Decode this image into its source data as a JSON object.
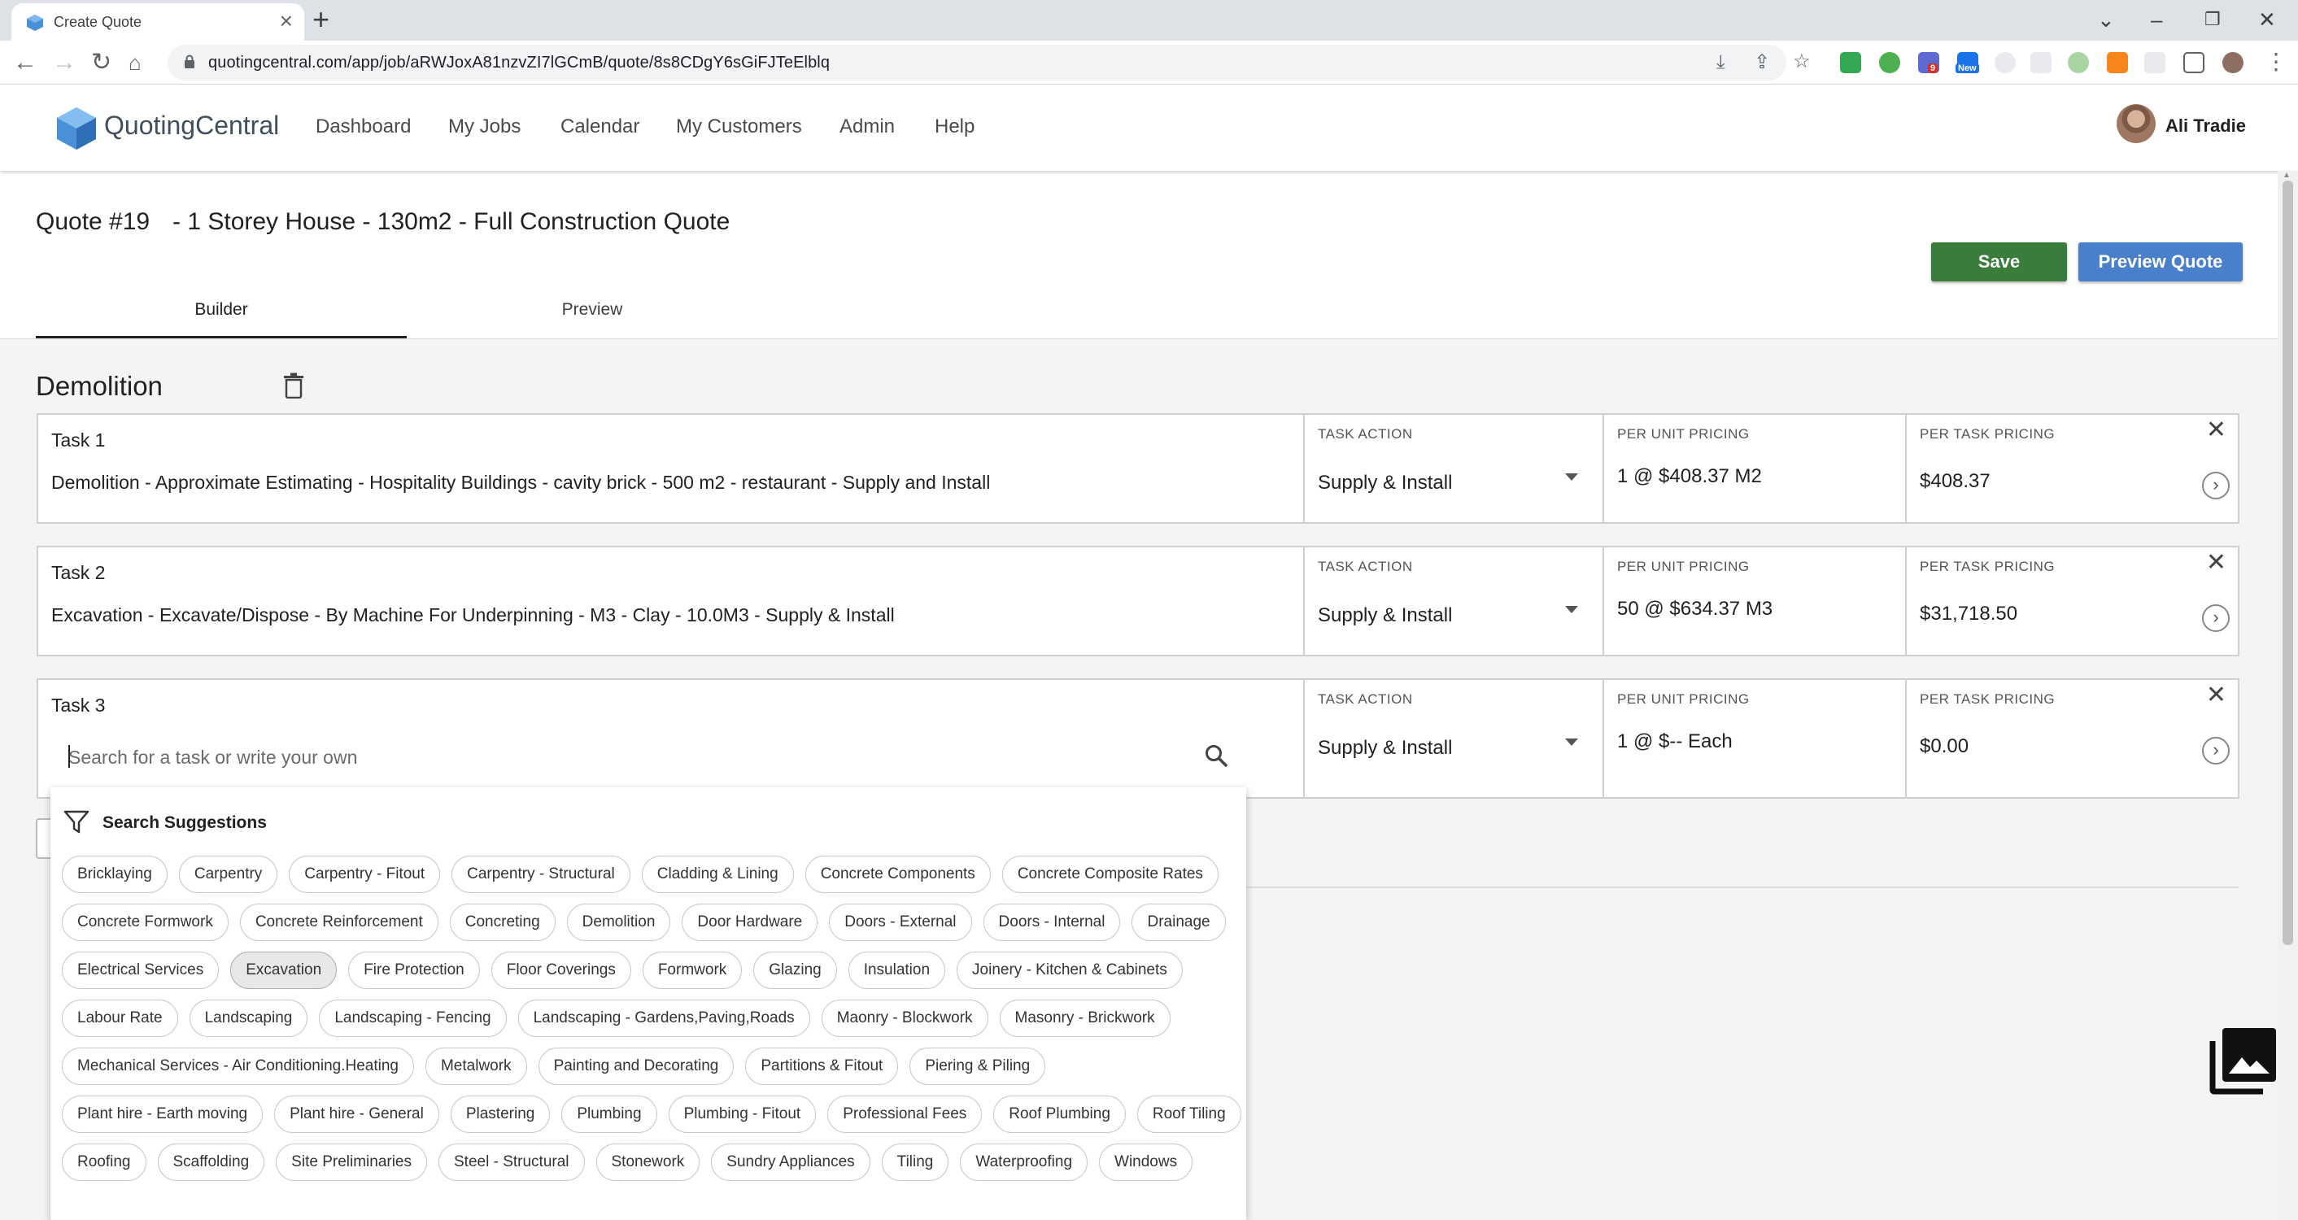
{
  "browser": {
    "tab_title": "Create Quote",
    "url": "quotingcentral.com/app/job/aRWJoxA81nzvZI7lGCmB/quote/8s8CDgY6sGiFJTeElblq",
    "ext_badge_1": "9",
    "ext_badge_2": "New"
  },
  "app": {
    "brand": "QuotingCentral",
    "nav": [
      "Dashboard",
      "My Jobs",
      "Calendar",
      "My Customers",
      "Admin",
      "Help"
    ],
    "user": "Ali Tradie"
  },
  "quote": {
    "number": "Quote #19",
    "title": "- 1 Storey House - 130m2 - Full Construction Quote",
    "save_label": "Save",
    "preview_label": "Preview Quote",
    "tabs": [
      "Builder",
      "Preview"
    ]
  },
  "section": {
    "title": "Demolition"
  },
  "column_labels": {
    "action": "TASK ACTION",
    "unit": "PER UNIT PRICING",
    "task": "PER TASK PRICING"
  },
  "tasks": [
    {
      "label": "Task 1",
      "description": "Demolition - Approximate Estimating - Hospitality Buildings - cavity brick - 500 m2 - restaurant - Supply and Install",
      "action": "Supply & Install",
      "unit_pricing": "1 @ $408.37 M2",
      "task_pricing": "$408.37"
    },
    {
      "label": "Task 2",
      "description": "Excavation - Excavate/Dispose - By Machine For Underpinning - M3 - Clay - 10.0M3 - Supply & Install",
      "action": "Supply & Install",
      "unit_pricing": "50 @ $634.37 M3",
      "task_pricing": "$31,718.50"
    },
    {
      "label": "Task 3",
      "search_placeholder": "Search for a task or write your own",
      "action": "Supply & Install",
      "unit_pricing": "1 @ $-- Each",
      "task_pricing": "$0.00"
    }
  ],
  "suggestions": {
    "heading": "Search Suggestions",
    "active": "Excavation",
    "rows": [
      [
        "Bricklaying",
        "Carpentry",
        "Carpentry - Fitout",
        "Carpentry - Structural",
        "Cladding & Lining",
        "Concrete Components",
        "Concrete Composite Rates"
      ],
      [
        "Concrete Formwork",
        "Concrete Reinforcement",
        "Concreting",
        "Demolition",
        "Door Hardware",
        "Doors - External",
        "Doors - Internal",
        "Drainage"
      ],
      [
        "Electrical Services",
        "Excavation",
        "Fire Protection",
        "Floor Coverings",
        "Formwork",
        "Glazing",
        "Insulation",
        "Joinery - Kitchen & Cabinets"
      ],
      [
        "Labour Rate",
        "Landscaping",
        "Landscaping - Fencing",
        "Landscaping - Gardens,Paving,Roads",
        "Maonry - Blockwork",
        "Masonry - Brickwork"
      ],
      [
        "Mechanical Services - Air Conditioning.Heating",
        "Metalwork",
        "Painting and Decorating",
        "Partitions & Fitout",
        "Piering & Piling"
      ],
      [
        "Plant hire - Earth moving",
        "Plant hire - General",
        "Plastering",
        "Plumbing",
        "Plumbing - Fitout",
        "Professional Fees",
        "Roof Plumbing",
        "Roof Tiling"
      ],
      [
        "Roofing",
        "Scaffolding",
        "Site Preliminaries",
        "Steel - Structural",
        "Stonework",
        "Sundry Appliances",
        "Tiling",
        "Waterproofing",
        "Windows"
      ]
    ]
  },
  "colors": {
    "save": "#3a7d3a",
    "preview": "#4a7fcc",
    "logo": "#4a90d9"
  }
}
